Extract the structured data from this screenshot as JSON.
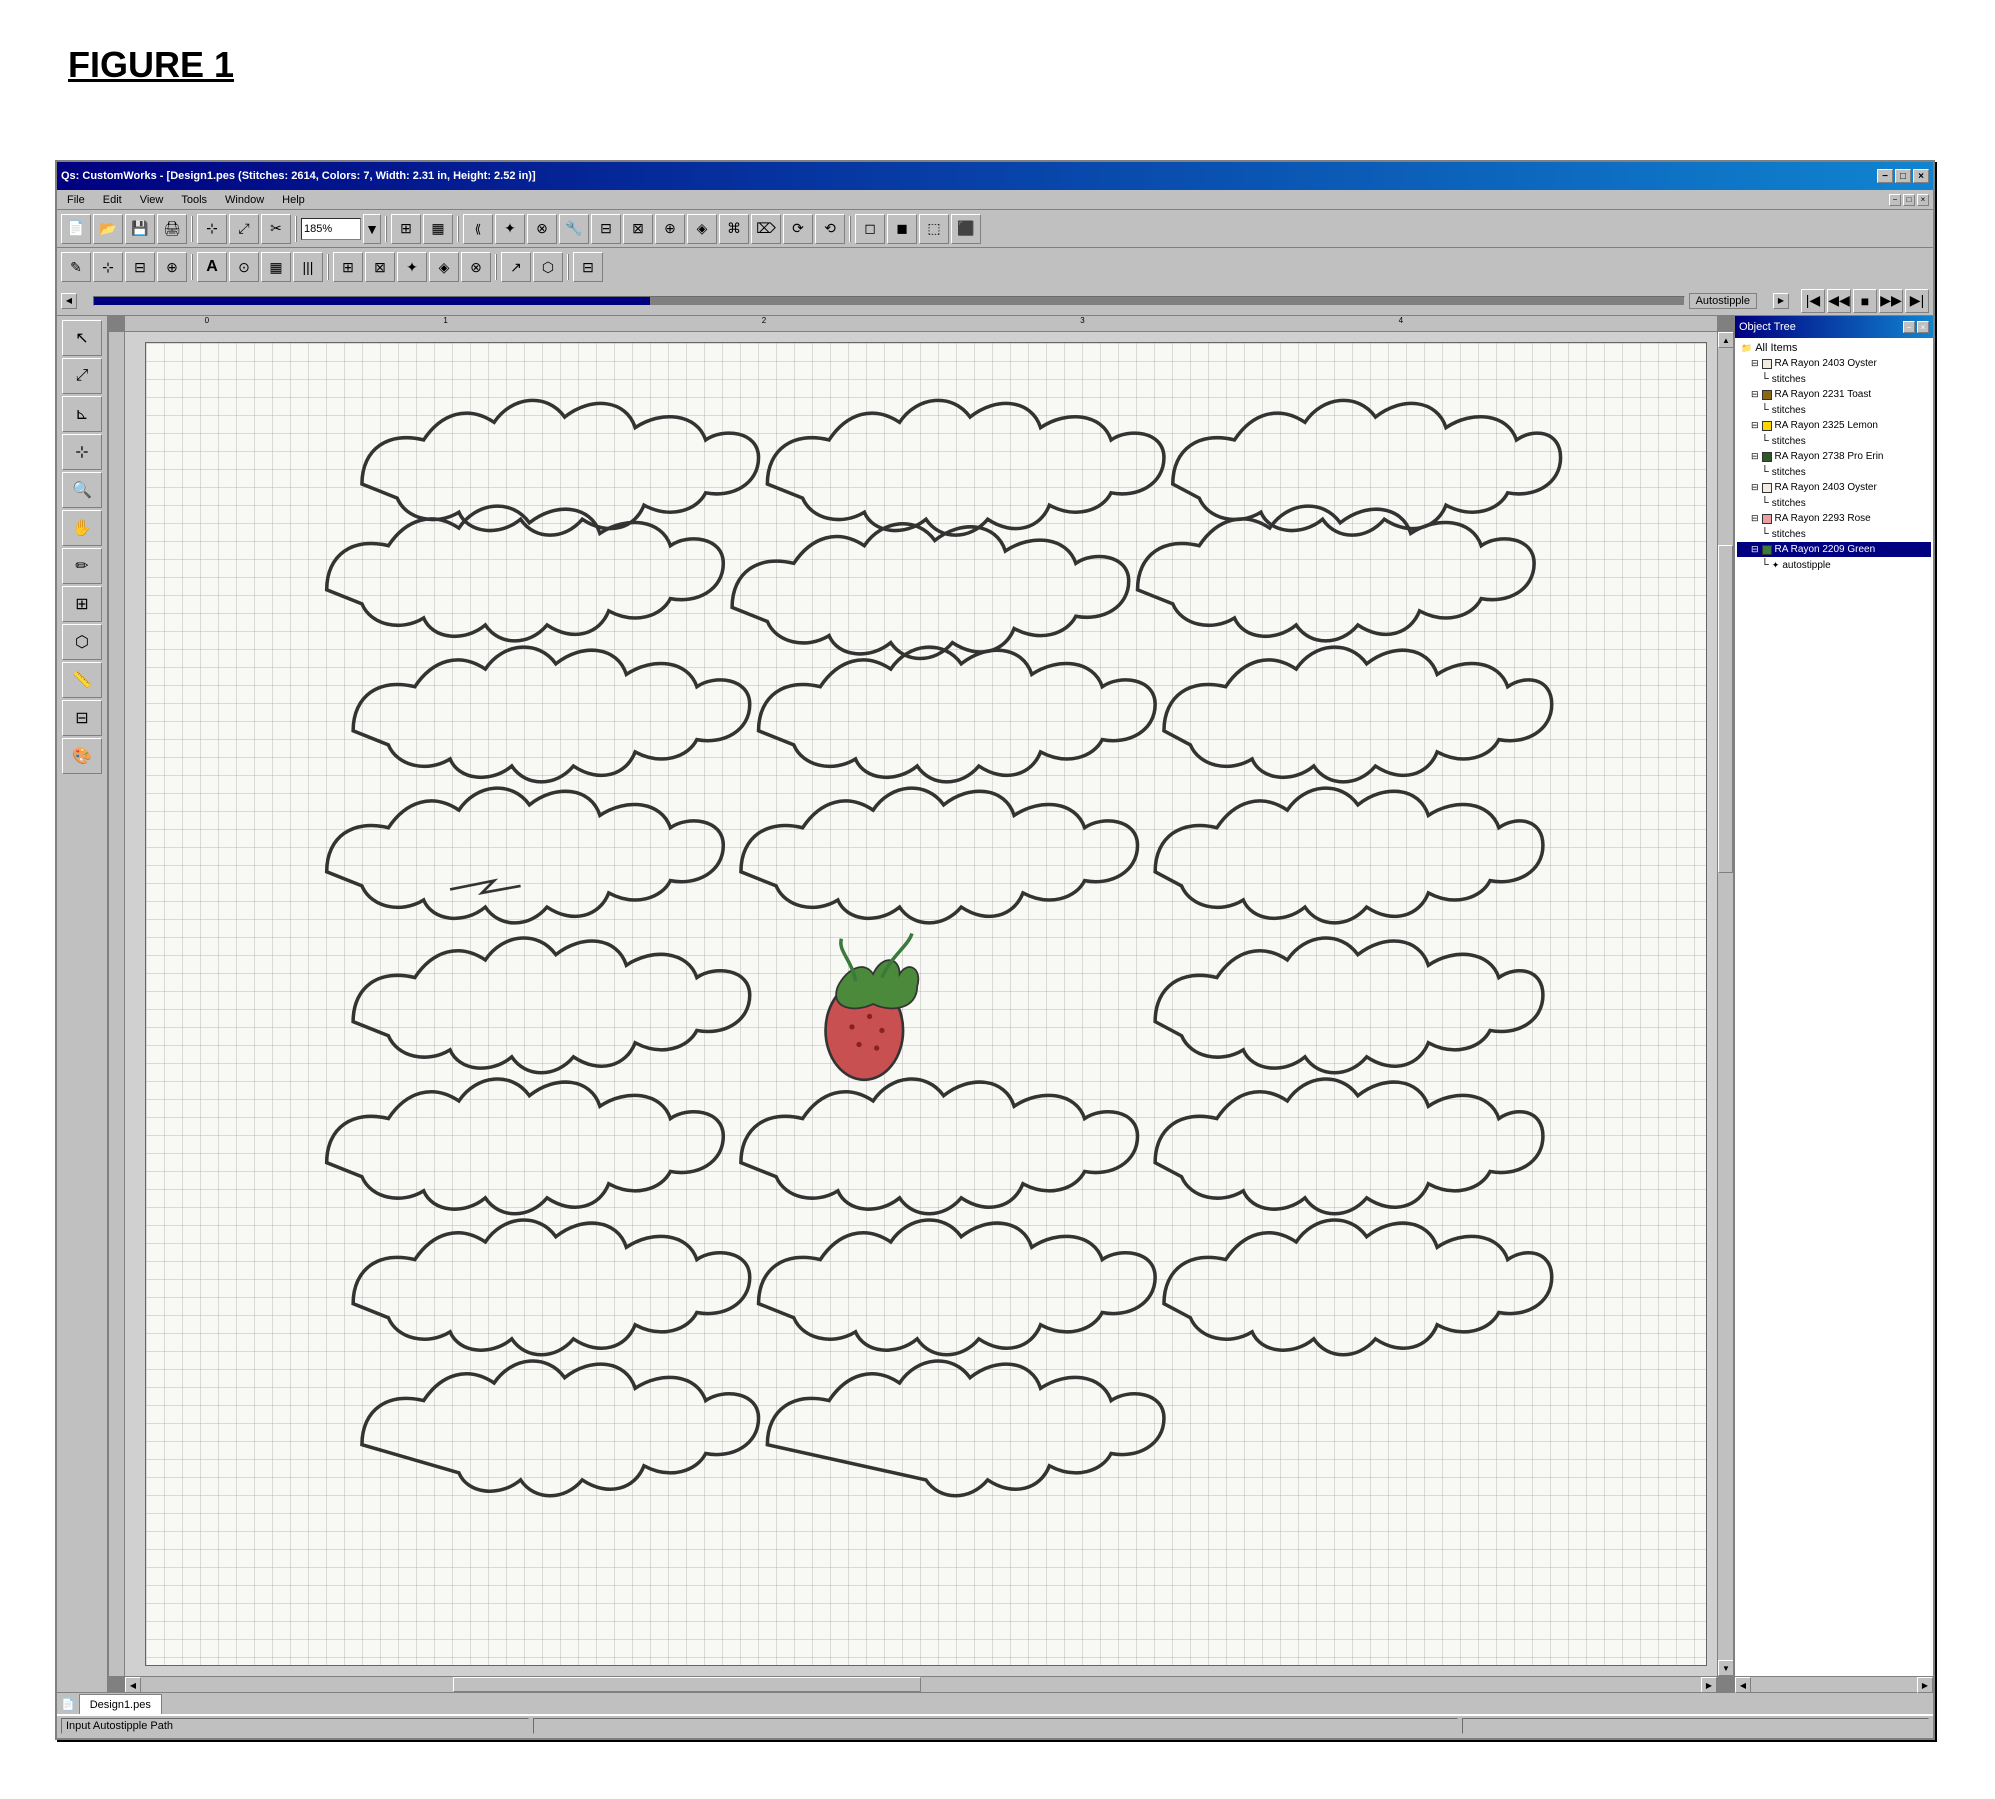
{
  "figure": {
    "label": "FIGURE 1"
  },
  "app": {
    "title": "Qs: CustomWorks - [Design1.pes (Stitches: 2614, Colors: 7, Width: 2.31 in, Height: 2.52 in)]",
    "inner_title": "Design1.pes",
    "zoom": "185%",
    "slider_label": "Autostipple",
    "status_text": "Input Autostipple Path",
    "tab_label": "Design1.pes"
  },
  "menu": {
    "items": [
      "File",
      "Edit",
      "View",
      "Tools",
      "Window",
      "Help"
    ]
  },
  "object_tree": {
    "title": "Object Tree",
    "items": [
      {
        "id": "all",
        "label": "All Items",
        "indent": 0,
        "color": null,
        "is_folder": true
      },
      {
        "id": "item1",
        "label": "RA Rayon 2403 Oyster",
        "indent": 1,
        "color": "#f0ece0",
        "is_folder": true
      },
      {
        "id": "item1a",
        "label": "stitches",
        "indent": 2,
        "color": null,
        "is_folder": false
      },
      {
        "id": "item2",
        "label": "RA Rayon 2231 Toast",
        "indent": 1,
        "color": "#8B6914",
        "is_folder": true
      },
      {
        "id": "item2a",
        "label": "stitches",
        "indent": 2,
        "color": null,
        "is_folder": false
      },
      {
        "id": "item3",
        "label": "RA Rayon 2325 Lemon",
        "indent": 1,
        "color": "#FFD700",
        "is_folder": true
      },
      {
        "id": "item3a",
        "label": "stitches",
        "indent": 2,
        "color": null,
        "is_folder": false
      },
      {
        "id": "item4",
        "label": "RA Rayon 2738 Pro Erin",
        "indent": 1,
        "color": "#2d5a27",
        "is_folder": true
      },
      {
        "id": "item4a",
        "label": "stitches",
        "indent": 2,
        "color": null,
        "is_folder": false
      },
      {
        "id": "item5",
        "label": "RA Rayon 2403 Oyster",
        "indent": 1,
        "color": "#f0ece0",
        "is_folder": true
      },
      {
        "id": "item5a",
        "label": "stitches",
        "indent": 2,
        "color": null,
        "is_folder": false
      },
      {
        "id": "item6",
        "label": "RA Rayon 2293 Rose",
        "indent": 1,
        "color": "#e8a0a0",
        "is_folder": true
      },
      {
        "id": "item6a",
        "label": "stitches",
        "indent": 2,
        "color": null,
        "is_folder": false
      },
      {
        "id": "item7",
        "label": "RA Rayon 2209 Green",
        "indent": 1,
        "color": "#3a7a3a",
        "is_folder": true
      },
      {
        "id": "item7a",
        "label": "autostipple",
        "indent": 2,
        "color": null,
        "is_folder": false
      }
    ]
  },
  "toolbar": {
    "zoom_value": "185%"
  },
  "icons": {
    "new": "📄",
    "open": "📂",
    "save": "💾",
    "print": "🖨",
    "cut": "✂",
    "copy": "📋",
    "paste": "📋",
    "undo": "↩",
    "redo": "↪",
    "minimize": "−",
    "maximize": "□",
    "close": "×"
  }
}
